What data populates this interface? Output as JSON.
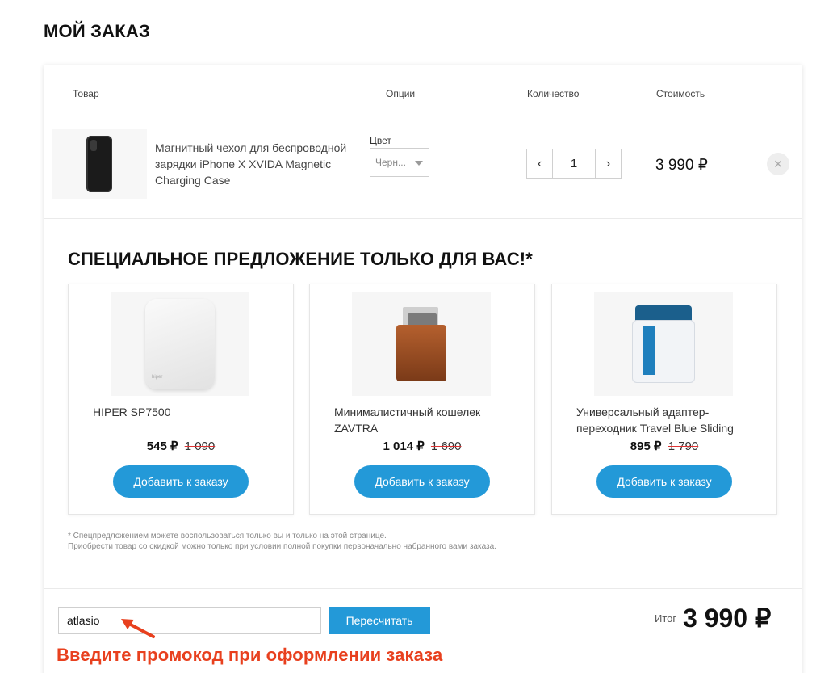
{
  "page": {
    "title": "МОЙ ЗАКАЗ"
  },
  "table": {
    "headers": {
      "product": "Товар",
      "options": "Опции",
      "quantity": "Количество",
      "cost": "Стоимость"
    },
    "row": {
      "name": "Магнитный чехол для беспроводной зарядки iPhone X XVIDA Magnetic Charging Case",
      "option_label": "Цвет",
      "option_value": "Черн...",
      "quantity": "1",
      "price": "3 990 ₽",
      "minus": "‹",
      "plus": "›",
      "remove": "×"
    }
  },
  "offers": {
    "title": "СПЕЦИАЛЬНОЕ ПРЕДЛОЖЕНИЕ ТОЛЬКО ДЛЯ ВАС!*",
    "items": [
      {
        "name": "HIPER SP7500",
        "price": "545 ₽",
        "old_price": "1 090",
        "button": "Добавить к заказу"
      },
      {
        "name": "Минималистичный кошелек ZAVTRA",
        "price": "1 014 ₽",
        "old_price": "1 690",
        "button": "Добавить к заказу"
      },
      {
        "name": "Универсальный адаптер-переходник Travel Blue Sliding",
        "price": "895 ₽",
        "old_price": "1 790",
        "button": "Добавить к заказу"
      }
    ],
    "footnote_1": "* Спецпредложением можете воспользоваться только вы и только на этой странице.",
    "footnote_2": "Приобрести товар со скидкой можно только при условии полной покупки первоначально набранного вами заказа."
  },
  "footer": {
    "promo_value": "atlasio",
    "recalc_button": "Пересчитать",
    "total_label": "Итог",
    "total_value": "3 990 ₽"
  },
  "annotation": {
    "hint": "Введите промокод при оформлении заказа"
  },
  "colors": {
    "accent": "#2399d8",
    "hint": "#e8401e"
  }
}
